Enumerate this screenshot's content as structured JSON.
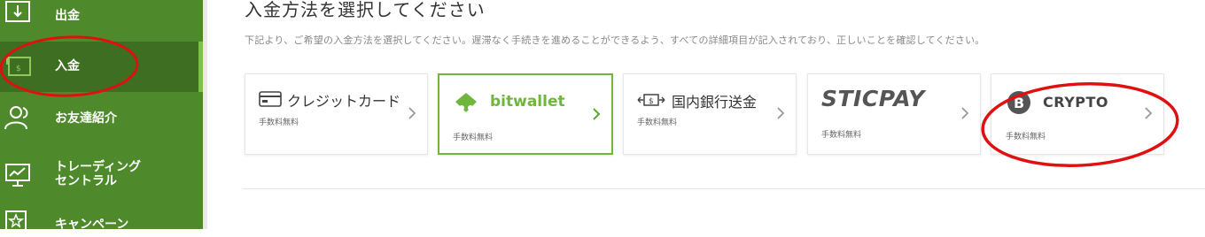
{
  "sidebar": {
    "items": [
      {
        "label": "出金",
        "icon": "withdraw-icon"
      },
      {
        "label": "入金",
        "icon": "deposit-icon",
        "active": true
      },
      {
        "label": "お友達紹介",
        "icon": "friends-icon"
      },
      {
        "label": "トレーディング\nセントラル",
        "icon": "trading-monitor-icon"
      },
      {
        "label": "キャンペーン",
        "icon": "campaign-star-icon"
      }
    ]
  },
  "main": {
    "title": "入金方法を選択してください",
    "description": "下記より、ご希望の入金方法を選択してください。遅滞なく手続きを進めることができるよう、すべての詳細項目が記入されており、正しいことを確認してください。",
    "methods": [
      {
        "name": "クレジットカード",
        "fee": "手数料無料",
        "icon": "credit-card-icon"
      },
      {
        "name": "bitwallet",
        "fee": "手数料無料",
        "icon": "bitwallet-logo",
        "selected": true
      },
      {
        "name": "国内銀行送金",
        "fee": "手数料無料",
        "icon": "bank-transfer-icon"
      },
      {
        "name": "STICPAY",
        "fee": "手数料無料",
        "icon": "sticpay-logo"
      },
      {
        "name": "CRYPTO",
        "fee": "手数料無料",
        "icon": "bitcoin-icon"
      }
    ]
  },
  "colors": {
    "sidebar_bg": "#4e8a2b",
    "sidebar_active": "#3e6e22",
    "accent_green": "#6fb63d",
    "annotation_red": "#e01010"
  }
}
